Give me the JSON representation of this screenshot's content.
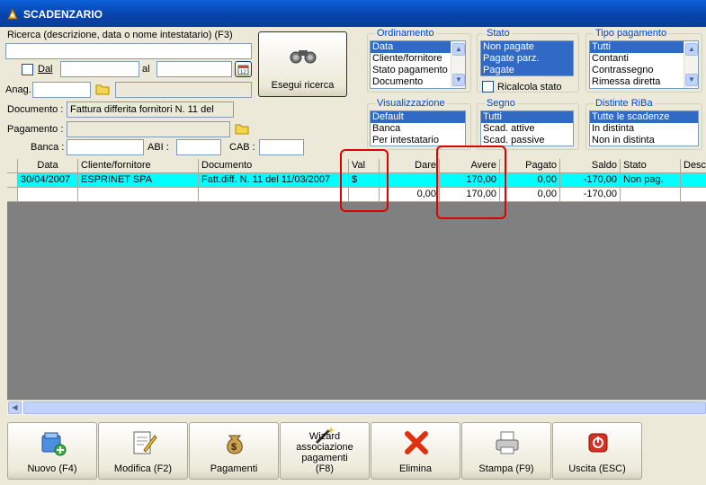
{
  "window": {
    "title": "SCADENZARIO"
  },
  "search": {
    "label": "Ricerca (descrizione, data o nome intestatario) (F3)",
    "value": "",
    "dal_label": "Dal",
    "al_label": "al",
    "anag_label": "Anag.",
    "button_label": "Esegui ricerca",
    "documento_label": "Documento :",
    "documento_value": "Fattura differita fornitori N. 11 del",
    "pagamento_label": "Pagamento :",
    "banca_label": "Banca :",
    "abi_label": "ABI :",
    "cab_label": "CAB :"
  },
  "ordinamento": {
    "title": "Ordinamento",
    "items": [
      "Data",
      "Cliente/fornitore",
      "Stato pagamento",
      "Documento"
    ],
    "selected": 0
  },
  "stato": {
    "title": "Stato",
    "items": [
      "Non pagate",
      "Pagate parz.",
      "Pagate"
    ],
    "ricalcola_label": "Ricalcola stato"
  },
  "tipo_pagamento": {
    "title": "Tipo pagamento",
    "items": [
      "Tutti",
      "Contanti",
      "Contrassegno",
      "Rimessa diretta"
    ],
    "selected": 0
  },
  "visualizzazione": {
    "title": "Visualizzazione",
    "items": [
      "Default",
      "Banca",
      "Per intestatario"
    ],
    "selected": 0
  },
  "segno": {
    "title": "Segno",
    "items": [
      "Tutti",
      "Scad. attive",
      "Scad. passive"
    ],
    "selected": 0
  },
  "distinte": {
    "title": "Distinte RiBa",
    "items": [
      "Tutte le scadenze",
      "In distinta",
      "Non in distinta"
    ],
    "selected": 0
  },
  "table": {
    "columns": [
      "Data",
      "Cliente/fornitore",
      "Documento",
      "Val",
      "Dare",
      "Avere",
      "Pagato",
      "Saldo",
      "Stato",
      "Desc"
    ],
    "rows": [
      [
        "30/04/2007",
        "ESPRINET SPA",
        "Fatt.diff. N. 11 del 11/03/2007",
        "$",
        "",
        "170,00",
        "0,00",
        "-170,00",
        "Non pag.",
        ""
      ],
      [
        "",
        "",
        "",
        "",
        "0,00",
        "170,00",
        "0,00",
        "-170,00",
        "",
        ""
      ]
    ]
  },
  "toolbar": {
    "nuovo": "Nuovo (F4)",
    "modifica": "Modifica (F2)",
    "pagamenti": "Pagamenti",
    "wizard": "Wizard associazione pagamenti (F8)",
    "elimina": "Elimina",
    "stampa": "Stampa (F9)",
    "uscita": "Uscita (ESC)"
  },
  "colors": {
    "selection": "#316ac5",
    "row_highlight": "#00ffff",
    "annotation": "#e00000"
  }
}
